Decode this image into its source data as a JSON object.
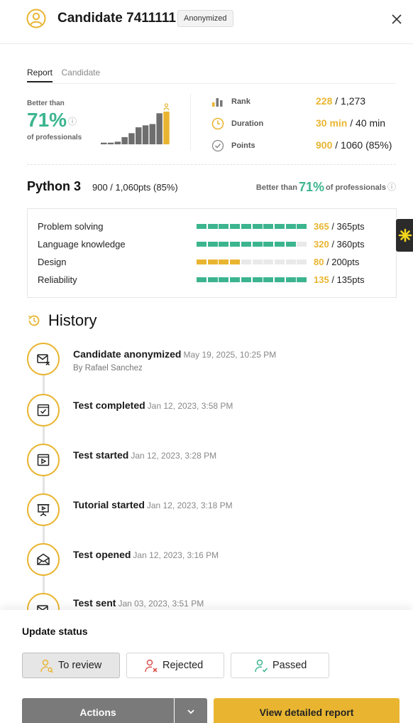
{
  "header": {
    "title": "Candidate 7411111",
    "badge": "Anonymized",
    "avatar_icon": "user-circle-icon",
    "close_icon": "close-icon"
  },
  "tabs": [
    {
      "label": "Report",
      "active": true
    },
    {
      "label": "Candidate",
      "active": false
    }
  ],
  "summary": {
    "better_than_label": "Better than",
    "percent": "71%",
    "of_professionals": "of professionals",
    "distribution_bars": [
      0.05,
      0.05,
      0.08,
      0.22,
      0.34,
      0.52,
      0.58,
      0.62,
      0.95,
      1.0
    ],
    "stats": [
      {
        "icon": "bar-chart-icon",
        "label": "Rank",
        "highlight": "228",
        "rest": " / 1,273"
      },
      {
        "icon": "clock-icon",
        "label": "Duration",
        "highlight": "30 min",
        "rest": " / 40 min"
      },
      {
        "icon": "check-circle-icon",
        "label": "Points",
        "highlight": "900",
        "rest": " / 1060 (85%)"
      }
    ]
  },
  "skill": {
    "name": "Python 3",
    "score": "900 / 1,060pts (85%)",
    "better_than": "Better than",
    "percent": "71%",
    "of_professionals": "of professionals",
    "rows": [
      {
        "name": "Problem solving",
        "filled": 10,
        "color": "#3cb58f",
        "highlight": "365",
        "rest": " / 365pts"
      },
      {
        "name": "Language knowledge",
        "filled": 9,
        "color": "#3cb58f",
        "highlight": "320",
        "rest": " / 360pts"
      },
      {
        "name": "Design",
        "filled": 4,
        "color": "#e9b531",
        "highlight": "80",
        "rest": " / 200pts"
      },
      {
        "name": "Reliability",
        "filled": 10,
        "color": "#3cb58f",
        "highlight": "135",
        "rest": " / 135pts"
      }
    ]
  },
  "history": {
    "title": "History",
    "items": [
      {
        "icon": "envelope-x-icon",
        "title": "Candidate anonymized",
        "date": "May 19, 2025, 10:25 PM",
        "by": "By Rafael Sanchez"
      },
      {
        "icon": "checkbox-icon",
        "title": "Test completed",
        "date": "Jan 12, 2023, 3:58 PM",
        "by": ""
      },
      {
        "icon": "play-window-icon",
        "title": "Test started",
        "date": "Jan 12, 2023, 3:28 PM",
        "by": ""
      },
      {
        "icon": "presentation-icon",
        "title": "Tutorial started",
        "date": "Jan 12, 2023, 3:18 PM",
        "by": ""
      },
      {
        "icon": "envelope-open-icon",
        "title": "Test opened",
        "date": "Jan 12, 2023, 3:16 PM",
        "by": ""
      },
      {
        "icon": "send-icon",
        "title": "Test sent",
        "date": "Jan 03, 2023, 3:51 PM",
        "by": ""
      }
    ]
  },
  "footer": {
    "update_status": "Update status",
    "status_buttons": [
      {
        "label": "To review",
        "icon": "user-search-icon",
        "selected": true
      },
      {
        "label": "Rejected",
        "icon": "user-x-icon",
        "selected": false
      },
      {
        "label": "Passed",
        "icon": "user-check-icon",
        "selected": false
      }
    ],
    "actions_label": "Actions",
    "report_label": "View detailed report"
  },
  "colors": {
    "accent_yellow": "#e9b531",
    "accent_green": "#3cb58f",
    "action_gray": "#7a7a7a"
  }
}
